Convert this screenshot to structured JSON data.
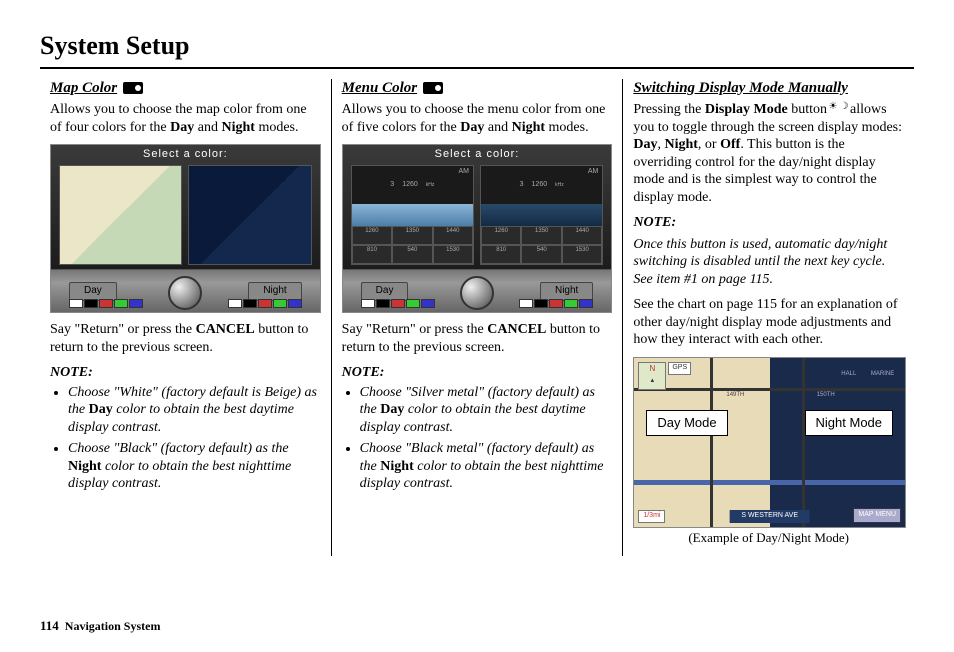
{
  "page_title": "System Setup",
  "page_number": "114",
  "footer_label": "Navigation System",
  "col1": {
    "heading": "Map Color",
    "intro_pre": "Allows you to choose the map color from one of four colors for the ",
    "intro_b1": "Day",
    "intro_mid": " and ",
    "intro_b2": "Night",
    "intro_post": " modes.",
    "figure_title": "Select a color:",
    "day_label": "Day",
    "night_label": "Night",
    "return_pre": "Say \"Return\" or press the ",
    "return_b": "CANCEL",
    "return_post": " button to return to the previous screen.",
    "note_label": "NOTE:",
    "note1_pre": "Choose \"White\" (factory default is Beige) as the ",
    "note1_b": "Day",
    "note1_post": " color to obtain the best daytime display contrast.",
    "note2_pre": "Choose \"Black\" (factory default) as the ",
    "note2_b": "Night",
    "note2_post": " color to obtain the best nighttime display contrast."
  },
  "col2": {
    "heading": "Menu Color",
    "intro_pre": "Allows you to choose the menu color from one of five colors for the ",
    "intro_b1": "Day",
    "intro_mid": " and ",
    "intro_b2": "Night",
    "intro_post": " modes.",
    "figure_title": "Select a color:",
    "day_label": "Day",
    "night_label": "Night",
    "radio_ch": "3",
    "radio_freq": "1260",
    "radio_unit": "kHz",
    "radio_am": "AM",
    "preset1": "1260",
    "preset2": "1350",
    "preset3": "1440",
    "preset4": "540",
    "preset5": "1530",
    "preset6": "810",
    "return_pre": "Say \"Return\" or press the ",
    "return_b": "CANCEL",
    "return_post": " button to return to the previous screen.",
    "note_label": "NOTE:",
    "note1_pre": "Choose \"Silver metal\" (factory default) as the ",
    "note1_b": "Day",
    "note1_post": " color to obtain the best daytime display contrast.",
    "note2_pre": "Choose \"Black metal\" (factory default) as the ",
    "note2_b": "Night",
    "note2_post": " color to obtain the best nighttime display contrast."
  },
  "col3": {
    "heading": "Switching Display Mode Manually",
    "p1_pre": "Pressing the ",
    "p1_b1": "Display Mode",
    "p1_mid1": " button ",
    "p1_mid2": " allows you to toggle through the screen display modes: ",
    "p1_b2": "Day",
    "p1_c1": ", ",
    "p1_b3": "Night",
    "p1_c2": ", or ",
    "p1_b4": "Off",
    "p1_post": ". This button is the overriding control for the day/night display mode and is the simplest way to control the display mode.",
    "note_label": "NOTE:",
    "note_body": "Once this button is used, automatic day/night switching is disabled until the next key cycle. See item #1 on page 115.",
    "p2": "See the chart on page 115 for an explanation of other day/night display mode adjustments and how they interact with each other.",
    "day_mode": "Day Mode",
    "night_mode": "Night Mode",
    "compass": "N",
    "gps": "GPS",
    "scale": "1/3mi",
    "street": "S WESTERN AVE",
    "mapmenu": "MAP MENU",
    "st149": "149TH",
    "st150": "150TH",
    "marine": "MARINE",
    "hall": "HALL",
    "caption": "(Example of Day/Night Mode)"
  }
}
